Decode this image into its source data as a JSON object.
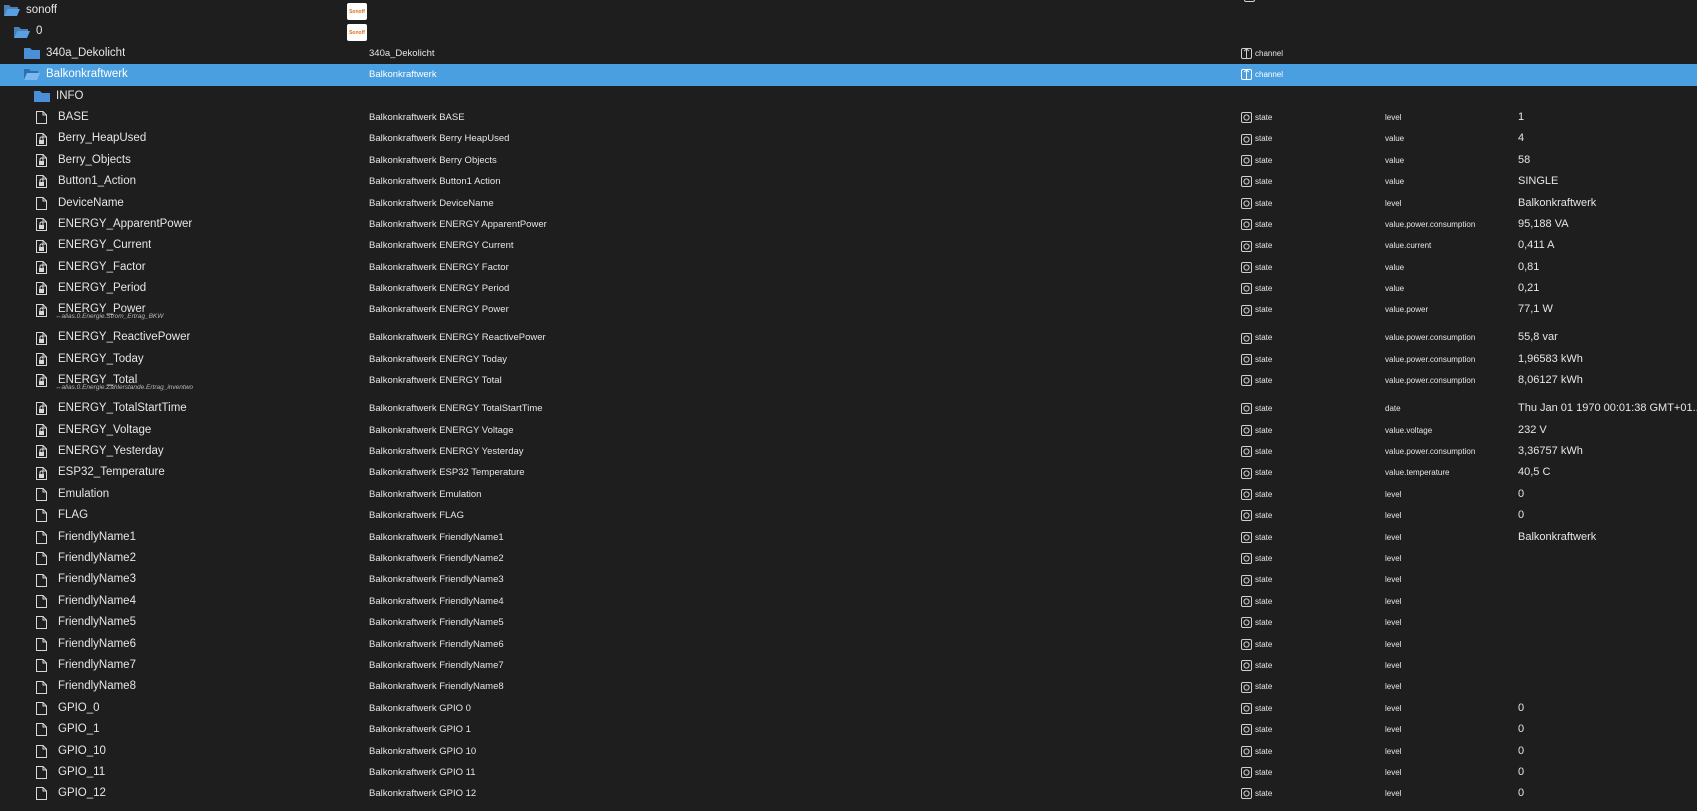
{
  "tree": {
    "root": {
      "label": "sonoff",
      "logo_text": "Sonoff"
    },
    "instance": {
      "label": "0",
      "logo_text": "Sonoff"
    },
    "channels": [
      {
        "id": "340a_Dekolicht",
        "name": "340a_Dekolicht",
        "type": "channel",
        "selected": false
      },
      {
        "id": "Balkonkraftwerk",
        "name": "Balkonkraftwerk",
        "type": "channel",
        "selected": true
      }
    ],
    "info_folder": {
      "label": "INFO"
    },
    "states": [
      {
        "id": "BASE",
        "name": "Balkonkraftwerk BASE",
        "type": "state",
        "role": "level",
        "value": "1"
      },
      {
        "id": "Berry_HeapUsed",
        "name": "Balkonkraftwerk Berry HeapUsed",
        "type": "state",
        "role": "value",
        "value": "4"
      },
      {
        "id": "Berry_Objects",
        "name": "Balkonkraftwerk Berry Objects",
        "type": "state",
        "role": "value",
        "value": "58"
      },
      {
        "id": "Button1_Action",
        "name": "Balkonkraftwerk Button1 Action",
        "type": "state",
        "role": "value",
        "value": "SINGLE"
      },
      {
        "id": "DeviceName",
        "name": "Balkonkraftwerk DeviceName",
        "type": "state",
        "role": "level",
        "value": "Balkonkraftwerk"
      },
      {
        "id": "ENERGY_ApparentPower",
        "name": "Balkonkraftwerk ENERGY ApparentPower",
        "type": "state",
        "role": "value.power.consumption",
        "value": "95,188 VA"
      },
      {
        "id": "ENERGY_Current",
        "name": "Balkonkraftwerk ENERGY Current",
        "type": "state",
        "role": "value.current",
        "value": "0,411 A"
      },
      {
        "id": "ENERGY_Factor",
        "name": "Balkonkraftwerk ENERGY Factor",
        "type": "state",
        "role": "value",
        "value": "0,81"
      },
      {
        "id": "ENERGY_Period",
        "name": "Balkonkraftwerk ENERGY Period",
        "type": "state",
        "role": "value",
        "value": "0,21"
      },
      {
        "id": "ENERGY_Power",
        "name": "Balkonkraftwerk ENERGY Power",
        "type": "state",
        "role": "value.power",
        "value": "77,1 W",
        "alias": "↔alias.0.Energie.Strom_Ertrag_BKW"
      },
      {
        "id": "ENERGY_ReactivePower",
        "name": "Balkonkraftwerk ENERGY ReactivePower",
        "type": "state",
        "role": "value.power.consumption",
        "value": "55,8 var"
      },
      {
        "id": "ENERGY_Today",
        "name": "Balkonkraftwerk ENERGY Today",
        "type": "state",
        "role": "value.power.consumption",
        "value": "1,96583 kWh"
      },
      {
        "id": "ENERGY_Total",
        "name": "Balkonkraftwerk ENERGY Total",
        "type": "state",
        "role": "value.power.consumption",
        "value": "8,06127 kWh",
        "alias": "↔alias.0.Energie.Zählerstande.Ertrag_inventwo"
      },
      {
        "id": "ENERGY_TotalStartTime",
        "name": "Balkonkraftwerk ENERGY TotalStartTime",
        "type": "state",
        "role": "date",
        "value": "Thu Jan 01 1970 00:01:38 GMT+01..."
      },
      {
        "id": "ENERGY_Voltage",
        "name": "Balkonkraftwerk ENERGY Voltage",
        "type": "state",
        "role": "value.voltage",
        "value": "232 V"
      },
      {
        "id": "ENERGY_Yesterday",
        "name": "Balkonkraftwerk ENERGY Yesterday",
        "type": "state",
        "role": "value.power.consumption",
        "value": "3,36757 kWh"
      },
      {
        "id": "ESP32_Temperature",
        "name": "Balkonkraftwerk ESP32 Temperature",
        "type": "state",
        "role": "value.temperature",
        "value": "40,5 C"
      },
      {
        "id": "Emulation",
        "name": "Balkonkraftwerk Emulation",
        "type": "state",
        "role": "level",
        "value": "0"
      },
      {
        "id": "FLAG",
        "name": "Balkonkraftwerk FLAG",
        "type": "state",
        "role": "level",
        "value": "0"
      },
      {
        "id": "FriendlyName1",
        "name": "Balkonkraftwerk FriendlyName1",
        "type": "state",
        "role": "level",
        "value": "Balkonkraftwerk"
      },
      {
        "id": "FriendlyName2",
        "name": "Balkonkraftwerk FriendlyName2",
        "type": "state",
        "role": "level",
        "value": ""
      },
      {
        "id": "FriendlyName3",
        "name": "Balkonkraftwerk FriendlyName3",
        "type": "state",
        "role": "level",
        "value": ""
      },
      {
        "id": "FriendlyName4",
        "name": "Balkonkraftwerk FriendlyName4",
        "type": "state",
        "role": "level",
        "value": ""
      },
      {
        "id": "FriendlyName5",
        "name": "Balkonkraftwerk FriendlyName5",
        "type": "state",
        "role": "level",
        "value": ""
      },
      {
        "id": "FriendlyName6",
        "name": "Balkonkraftwerk FriendlyName6",
        "type": "state",
        "role": "level",
        "value": ""
      },
      {
        "id": "FriendlyName7",
        "name": "Balkonkraftwerk FriendlyName7",
        "type": "state",
        "role": "level",
        "value": ""
      },
      {
        "id": "FriendlyName8",
        "name": "Balkonkraftwerk FriendlyName8",
        "type": "state",
        "role": "level",
        "value": ""
      },
      {
        "id": "GPIO_0",
        "name": "Balkonkraftwerk GPIO 0",
        "type": "state",
        "role": "level",
        "value": "0"
      },
      {
        "id": "GPIO_1",
        "name": "Balkonkraftwerk GPIO 1",
        "type": "state",
        "role": "level",
        "value": "0"
      },
      {
        "id": "GPIO_10",
        "name": "Balkonkraftwerk GPIO 10",
        "type": "state",
        "role": "level",
        "value": "0"
      },
      {
        "id": "GPIO_11",
        "name": "Balkonkraftwerk GPIO 11",
        "type": "state",
        "role": "level",
        "value": "0"
      },
      {
        "id": "GPIO_12",
        "name": "Balkonkraftwerk GPIO 12",
        "type": "state",
        "role": "level",
        "value": "0"
      }
    ]
  },
  "icons": {
    "folder_open": "folder-open-icon",
    "folder_closed": "folder-icon",
    "file": "file-icon",
    "file_locked": "file-readonly-icon",
    "channel": "channel-icon",
    "state": "state-icon"
  },
  "colors": {
    "background": "#1e1e1e",
    "selected": "#4a9fe0",
    "folder": "#4a9fe0",
    "text": "#e6e6e6"
  }
}
